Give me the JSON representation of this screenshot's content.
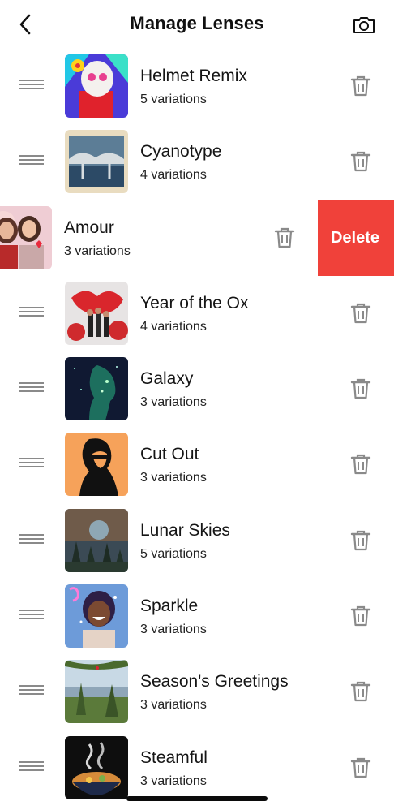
{
  "header": {
    "title": "Manage Lenses",
    "back_icon": "chevron-left-icon",
    "camera_icon": "camera-icon"
  },
  "lenses": [
    {
      "name": "Helmet Remix",
      "variations": "5 variations",
      "thumb": "helmet"
    },
    {
      "name": "Cyanotype",
      "variations": "4 variations",
      "thumb": "cyanotype"
    },
    {
      "name": "Amour",
      "variations": "3 variations",
      "thumb": "amour",
      "swiped": true,
      "delete_label": "Delete"
    },
    {
      "name": "Year of the Ox",
      "variations": "4 variations",
      "thumb": "ox"
    },
    {
      "name": "Galaxy",
      "variations": "3 variations",
      "thumb": "galaxy"
    },
    {
      "name": "Cut Out",
      "variations": "3 variations",
      "thumb": "cutout"
    },
    {
      "name": "Lunar Skies",
      "variations": "5 variations",
      "thumb": "lunar"
    },
    {
      "name": "Sparkle",
      "variations": "3 variations",
      "thumb": "sparkle"
    },
    {
      "name": "Season's Greetings",
      "variations": "3 variations",
      "thumb": "season"
    },
    {
      "name": "Steamful",
      "variations": "3 variations",
      "thumb": "steamful"
    }
  ],
  "colors": {
    "delete_red": "#f0413a",
    "icon_gray": "#8a8a8a",
    "divider": "#e6e6e6"
  }
}
